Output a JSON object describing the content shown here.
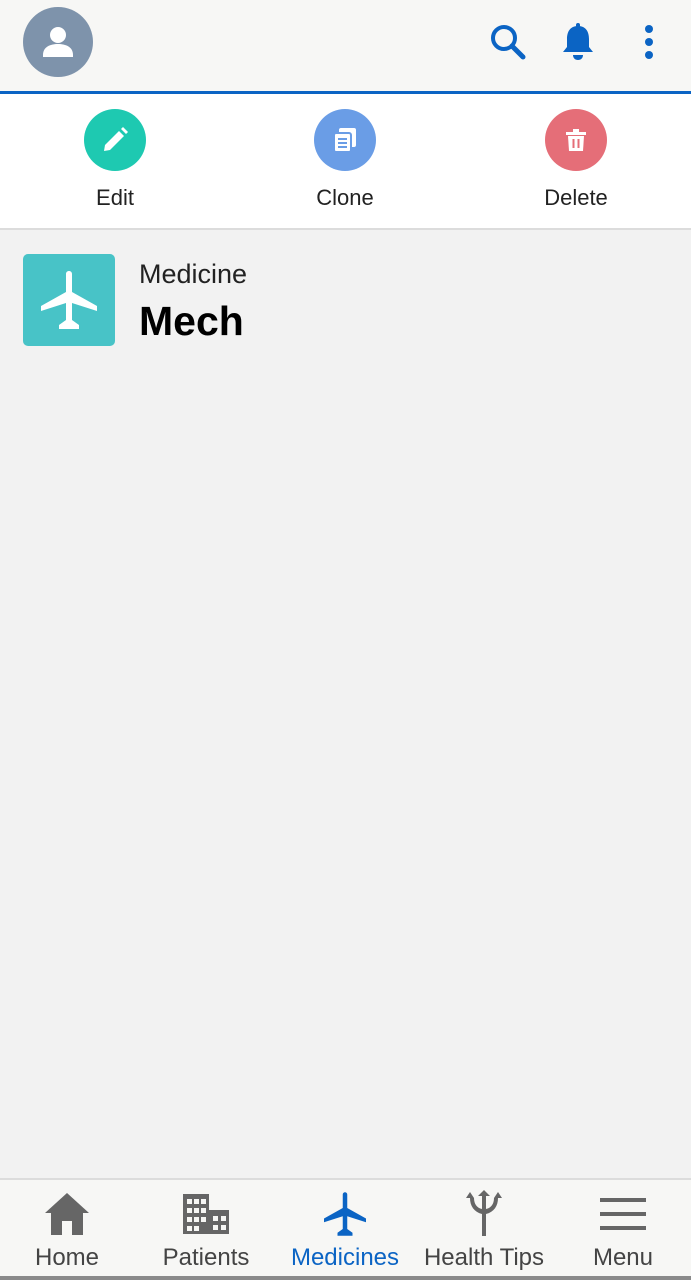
{
  "header": {
    "avatar_icon": "user-icon",
    "search_icon": "search-icon",
    "notification_icon": "bell-icon",
    "more_icon": "more-vertical-icon",
    "accent_color": "#0b64c4"
  },
  "actions": [
    {
      "label": "Edit",
      "icon": "pencil-icon",
      "color": "#1ec9b1"
    },
    {
      "label": "Clone",
      "icon": "copy-icon",
      "color": "#6a9de6"
    },
    {
      "label": "Delete",
      "icon": "trash-icon",
      "color": "#e56e78"
    }
  ],
  "record": {
    "type_label": "Medicine",
    "name": "Mech",
    "icon": "airplane-icon",
    "tile_color": "#48c3c7"
  },
  "bottom_nav": {
    "items": [
      {
        "label": "Home",
        "icon": "home-icon",
        "active": false
      },
      {
        "label": "Patients",
        "icon": "building-icon",
        "active": false
      },
      {
        "label": "Medicines",
        "icon": "airplane-icon",
        "active": true
      },
      {
        "label": "Health Tips",
        "icon": "trident-icon",
        "active": false
      },
      {
        "label": "Menu",
        "icon": "hamburger-icon",
        "active": false
      }
    ]
  }
}
